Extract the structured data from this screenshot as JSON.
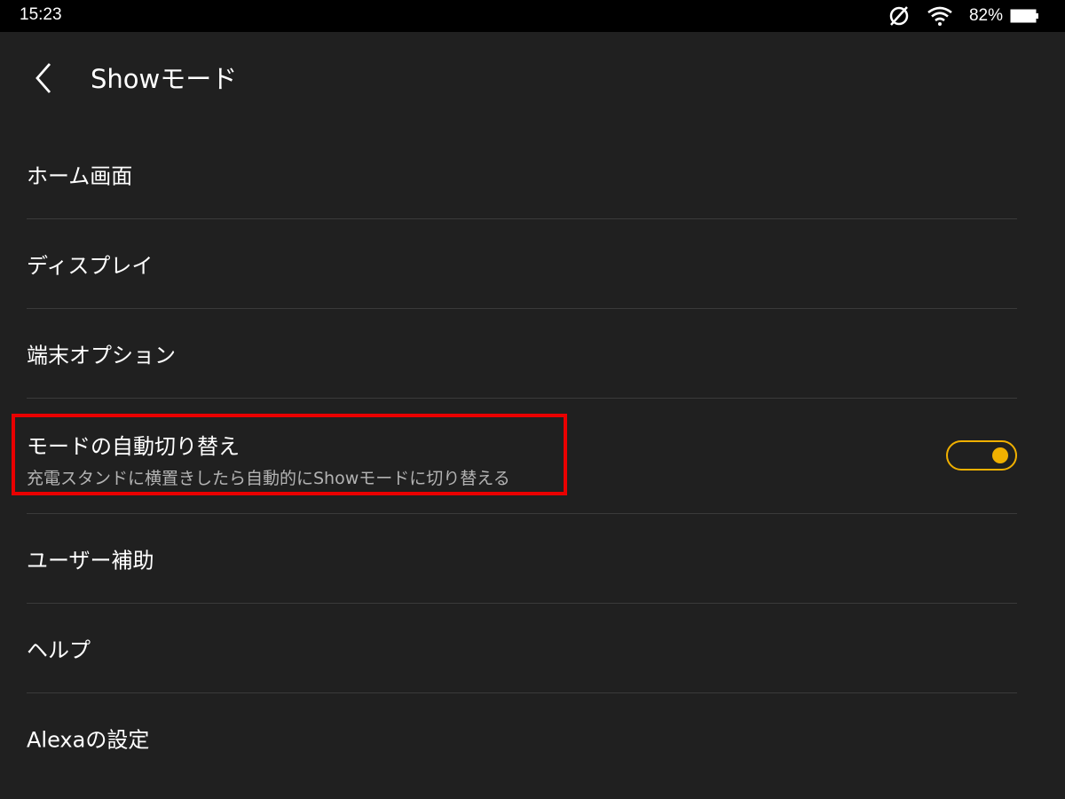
{
  "status_bar": {
    "time": "15:23",
    "battery_percent": "82%",
    "icons": [
      "no-sim-icon",
      "wifi-icon",
      "battery-icon"
    ]
  },
  "header": {
    "title": "Showモード",
    "back_icon": "chevron-left-icon"
  },
  "settings": {
    "items": [
      {
        "label": "ホーム画面"
      },
      {
        "label": "ディスプレイ"
      },
      {
        "label": "端末オプション"
      },
      {
        "label": "モードの自動切り替え",
        "description": "充電スタンドに横置きしたら自動的にShowモードに切り替える",
        "toggle_on": true
      },
      {
        "label": "ユーザー補助"
      },
      {
        "label": "ヘルプ"
      },
      {
        "label": "Alexaの設定"
      }
    ]
  },
  "colors": {
    "accent": "#f0b000",
    "highlight": "#ea0000",
    "background": "#202020"
  }
}
